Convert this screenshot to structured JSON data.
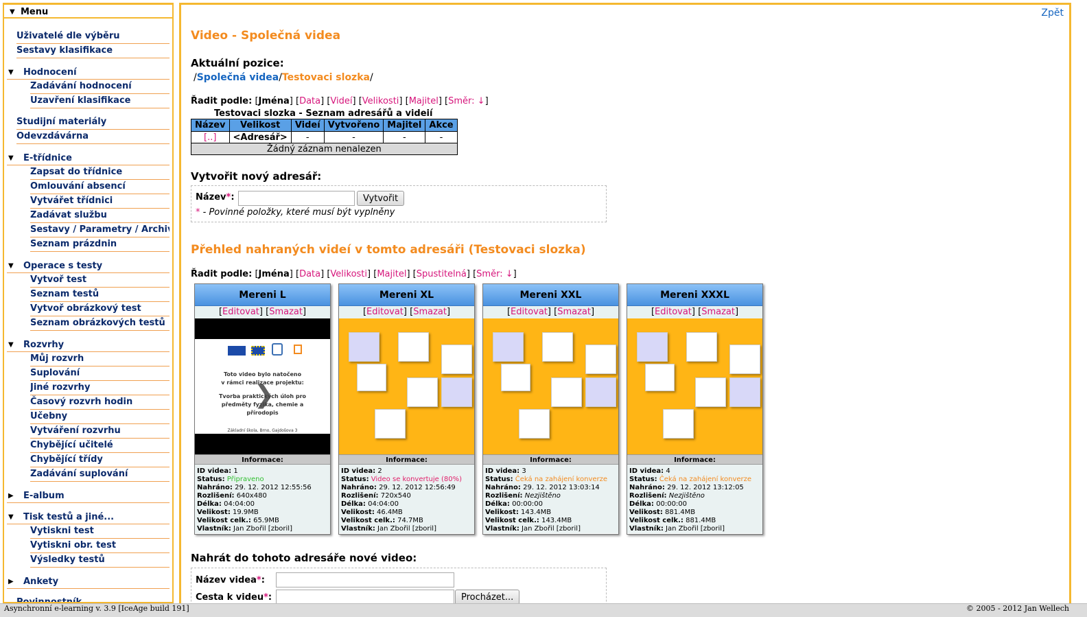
{
  "sidebar": {
    "menu_label": "Menu",
    "top_items": [
      "Uživatelé dle výběru",
      "Sestavy klasifikace"
    ],
    "sections": [
      {
        "label": "Hodnocení",
        "expanded": true,
        "items": [
          "Zadávání hodnocení",
          "Uzavření klasifikace"
        ]
      },
      {
        "label": null,
        "plain": [
          "Studijní materiály",
          "Odevzdávárna"
        ]
      },
      {
        "label": "E-třídnice",
        "expanded": true,
        "items": [
          "Zapsat do třídnice",
          "Omlouvání absencí",
          "Vytvářet třídnici",
          "Zadávat službu",
          "Sestavy / Parametry / Archiv",
          "Seznam prázdnin"
        ]
      },
      {
        "label": "Operace s testy",
        "expanded": true,
        "items": [
          "Vytvoř test",
          "Seznam testů",
          "Vytvoř obrázkový test",
          "Seznam obrázkových testů"
        ]
      },
      {
        "label": "Rozvrhy",
        "expanded": true,
        "items": [
          "Můj rozvrh",
          "Suplování",
          "Jiné rozvrhy",
          "Časový rozvrh hodin",
          "Učebny",
          "Vytváření rozvrhu",
          "Chybějící učitelé",
          "Chybějící třídy",
          "Zadávání suplování"
        ]
      },
      {
        "label": "E-album",
        "expanded": false,
        "items": []
      },
      {
        "label": "Tisk testů a jiné...",
        "expanded": true,
        "items": [
          "Vytiskni test",
          "Vytiskni obr. test",
          "Výsledky testů"
        ]
      },
      {
        "label": "Ankety",
        "expanded": false,
        "items": []
      }
    ],
    "bottom_item": "Povinnostník"
  },
  "main": {
    "back_link": "Zpět",
    "title": "Video - Společná videa",
    "position_label": "Aktuální pozice:",
    "breadcrumb": {
      "sep": "/",
      "root": "Společná videa",
      "current": "Testovaci slozka"
    },
    "sort1": {
      "label": "Řadit podle:",
      "items": [
        "Jména",
        "Data",
        "Videí",
        "Velikosti",
        "Majitel",
        "Směr: ↓"
      ],
      "active": "Jména"
    },
    "dir_table": {
      "caption": "Testovaci slozka - Seznam adresářů a videií",
      "headers": [
        "Název",
        "Velikost",
        "Videí",
        "Vytvořeno",
        "Majitel",
        "Akce"
      ],
      "row": [
        "[..]",
        "<Adresář>",
        "-",
        "-",
        "-",
        "-"
      ],
      "empty": "Žádný záznam nenalezen"
    },
    "new_dir": {
      "title": "Vytvořit nový adresář:",
      "name_label": "Název",
      "required_star": "*",
      "colon": ":",
      "button": "Vytvořit",
      "note": "- Povinné položky, které musí být vyplněny"
    },
    "overview_title": "Přehled nahraných videí v tomto adresáři (Testovaci slozka)",
    "sort2": {
      "label": "Řadit podle:",
      "items": [
        "Jména",
        "Data",
        "Velikosti",
        "Majitel",
        "Spustitelná",
        "Směr: ↓"
      ],
      "active": "Jména"
    },
    "info_labels": {
      "header": "Informace:",
      "id": "ID videa:",
      "status": "Status:",
      "uploaded": "Nahráno:",
      "resolution": "Rozlišení:",
      "length": "Délka:",
      "size": "Velikost:",
      "size_total": "Velikost celk.:",
      "owner": "Vlastník:"
    },
    "actions": {
      "edit": "Editovat",
      "delete": "Smazat"
    },
    "videos": [
      {
        "name": "Mereni L",
        "id": "1",
        "status": "Připraveno",
        "status_color": "#2fbf2f",
        "uploaded": "29. 12. 2012 12:55:56",
        "resolution": "640x480",
        "resolution_italic": false,
        "length": "04:04:00",
        "size": "19.9MB",
        "size_total": "65.9MB",
        "owner": "Jan Zbořil [zboril]",
        "thumb": "video",
        "thumb_text": [
          "Toto video bylo natočeno",
          "v rámci realizace projektu:",
          "Tvorba praktických úloh pro",
          "předměty fyzika, chemie a",
          "přírodopis",
          "Základní škola, Brno, Gajdošova 3"
        ]
      },
      {
        "name": "Mereni XL",
        "id": "2",
        "status": "Video se konvertuje (80%)",
        "status_color": "#e0206a",
        "uploaded": "29. 12. 2012 12:56:49",
        "resolution": "720x540",
        "resolution_italic": false,
        "length": "04:04:00",
        "size": "46.4MB",
        "size_total": "74.7MB",
        "owner": "Jan Zbořil [zboril]",
        "thumb": "placeholder"
      },
      {
        "name": "Mereni XXL",
        "id": "3",
        "status": "Čeká na zahájení konverze",
        "status_color": "#f38b1f",
        "uploaded": "29. 12. 2012 13:03:14",
        "resolution": "Nezjištěno",
        "resolution_italic": true,
        "length": "00:00:00",
        "size": "143.4MB",
        "size_total": "143.4MB",
        "owner": "Jan Zbořil [zboril]",
        "thumb": "placeholder"
      },
      {
        "name": "Mereni XXXL",
        "id": "4",
        "status": "Čeká na zahájení konverze",
        "status_color": "#f38b1f",
        "uploaded": "29. 12. 2012 13:12:05",
        "resolution": "Nezjištěno",
        "resolution_italic": true,
        "length": "00:00:00",
        "size": "881.4MB",
        "size_total": "881.4MB",
        "owner": "Jan Zbořil [zboril]",
        "thumb": "placeholder"
      }
    ],
    "upload": {
      "title": "Nahrát do tohoto adresáře nové video:",
      "video_name_label": "Název videa",
      "path_label": "Cesta k videu",
      "required_star": "*",
      "colon": ":",
      "browse_button": "Procházet..."
    }
  },
  "footer": {
    "left": "Asynchronní e-learning  v. 3.9 [IceAge build 191]",
    "right": "© 2005 - 2012  Jan Wellech"
  },
  "colors": {
    "accent_border": "#f5b830",
    "title_orange": "#f38b1f",
    "link_pink": "#d6157b",
    "link_blue": "#1565c0",
    "table_header": "#5aa0e6",
    "thumb_orange": "#ffb515"
  }
}
